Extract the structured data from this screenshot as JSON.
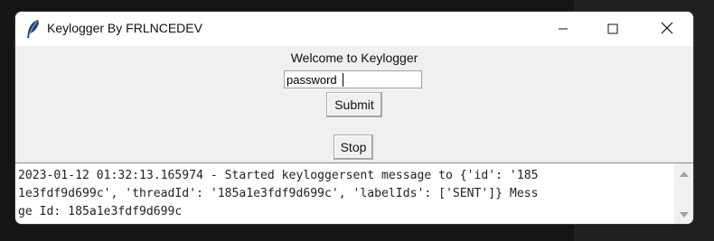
{
  "window": {
    "title": "Keylogger By FRLNCEDEV",
    "icon": "feather-icon",
    "controls": [
      "minimize-icon",
      "maximize-icon",
      "close-icon"
    ]
  },
  "form": {
    "welcome_label": "Welcome to Keylogger",
    "input_value": "password",
    "submit_label": "Submit",
    "stop_label": "Stop"
  },
  "log": {
    "lines": [
      "2023-01-12 01:32:13.165974 - Started keyloggersent message to {'id': '185",
      "1e3fdf9d699c', 'threadId': '185a1e3fdf9d699c', 'labelIds': ['SENT']} Mess",
      "ge Id: 185a1e3fdf9d699c"
    ]
  }
}
